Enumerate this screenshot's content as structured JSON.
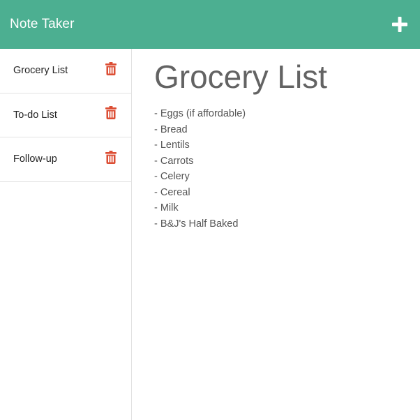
{
  "app": {
    "title": "Note Taker",
    "accent_color": "#4caf91",
    "danger_color": "#dc4e34",
    "add_icon": "plus-icon",
    "delete_icon": "trash-icon"
  },
  "sidebar": {
    "notes": [
      {
        "title": "Grocery List"
      },
      {
        "title": "To-do List"
      },
      {
        "title": "Follow-up"
      }
    ]
  },
  "main": {
    "title": "Grocery List",
    "lines": [
      "- Eggs (if affordable)",
      "- Bread",
      "- Lentils",
      "- Carrots",
      "- Celery",
      "- Cereal",
      "- Milk",
      "- B&J's Half Baked"
    ]
  }
}
